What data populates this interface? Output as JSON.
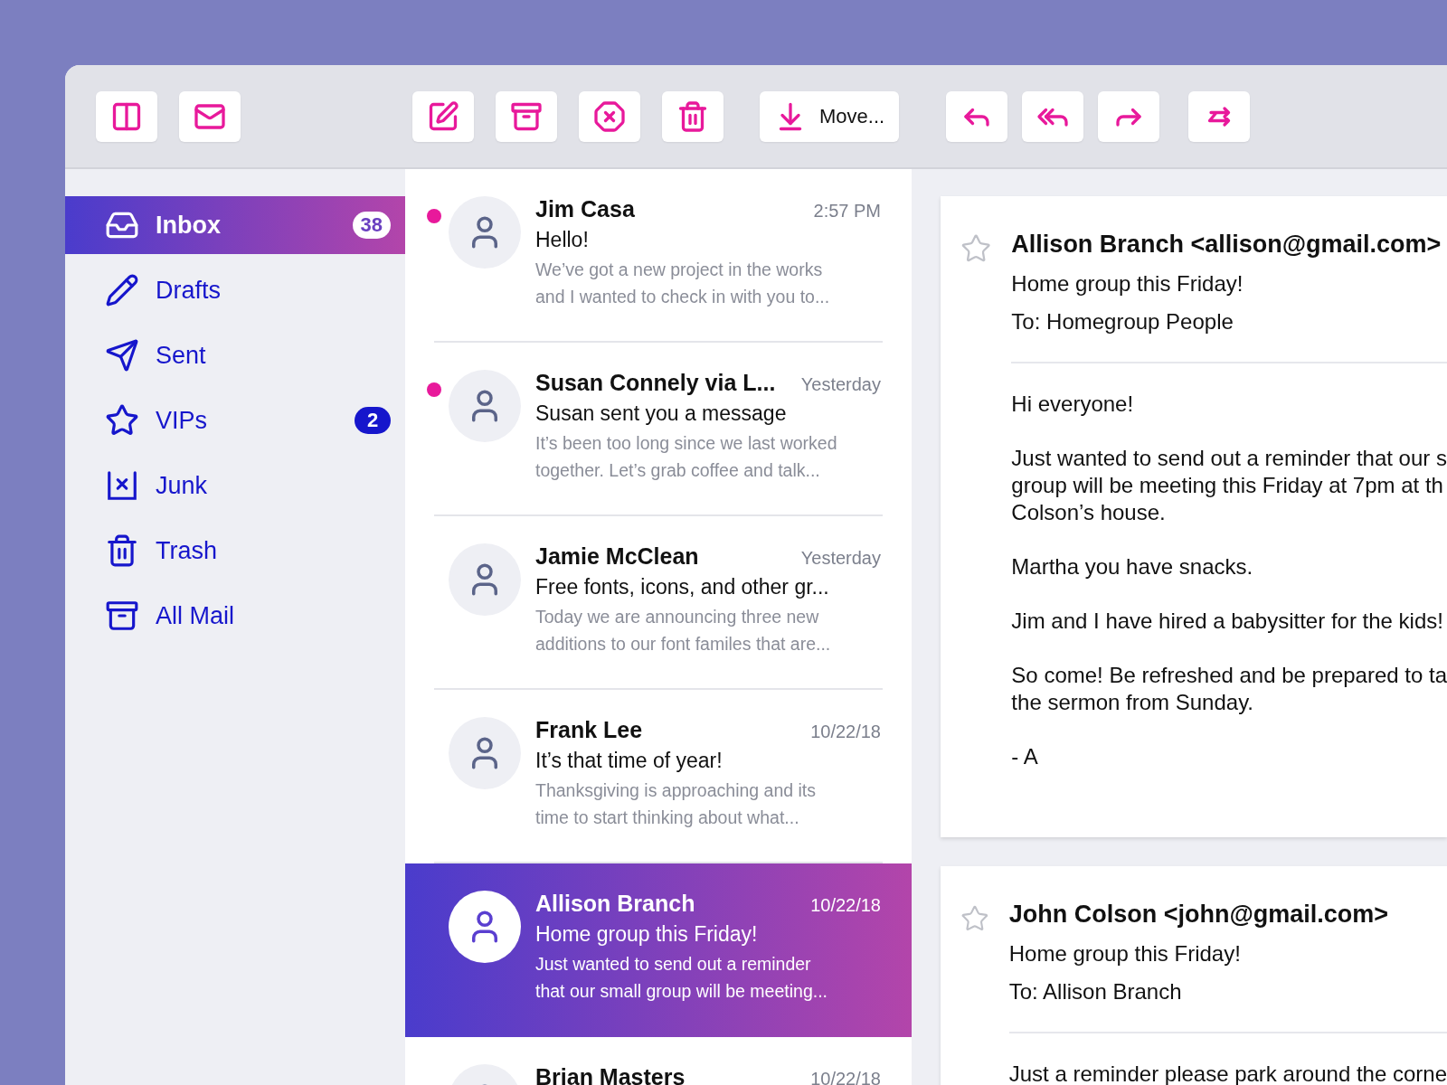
{
  "toolbar": {
    "move_label": "Move..."
  },
  "sidebar": {
    "items": [
      {
        "label": "Inbox",
        "count": "38",
        "selected": true
      },
      {
        "label": "Drafts",
        "selected": false
      },
      {
        "label": "Sent",
        "selected": false
      },
      {
        "label": "VIPs",
        "count": "2",
        "selected": false
      },
      {
        "label": "Junk",
        "selected": false
      },
      {
        "label": "Trash",
        "selected": false
      },
      {
        "label": "All Mail",
        "selected": false
      }
    ]
  },
  "messages": [
    {
      "sender": "Jim Casa",
      "time": "2:57 PM",
      "subject": "Hello!",
      "preview": [
        "We’ve got a new project in the works",
        "and I wanted to check in with you to..."
      ],
      "unread": true,
      "selected": false
    },
    {
      "sender": "Susan Connely via L...",
      "time": "Yesterday",
      "subject": "Susan sent you a message",
      "preview": [
        "It’s been too long since we last worked",
        "together. Let’s grab coffee and talk..."
      ],
      "unread": true,
      "selected": false
    },
    {
      "sender": "Jamie McClean",
      "time": "Yesterday",
      "subject": "Free fonts, icons, and other gr...",
      "preview": [
        "Today we are announcing three new",
        "additions to our font familes that are..."
      ],
      "unread": false,
      "selected": false
    },
    {
      "sender": "Frank Lee",
      "time": "10/22/18",
      "subject": "It’s that time of year!",
      "preview": [
        "Thanksgiving is approaching and its",
        "time to start thinking about what..."
      ],
      "unread": false,
      "selected": false
    },
    {
      "sender": "Allison Branch",
      "time": "10/22/18",
      "subject": "Home group this Friday!",
      "preview": [
        "Just wanted to send out a reminder",
        "that our small group will be meeting..."
      ],
      "unread": false,
      "selected": true
    },
    {
      "sender": "Brian Masters",
      "time": "10/22/18",
      "unread": false,
      "selected": false
    }
  ],
  "thread": [
    {
      "from": "Allison Branch <allison@gmail.com>",
      "subject": "Home group this Friday!",
      "to": "To: Homegroup People",
      "body": [
        [
          "Hi everyone!"
        ],
        [
          "Just wanted to send out a reminder that our s",
          "group will be meeting this Friday at 7pm at th",
          "Colson’s house."
        ],
        [
          "Martha you have snacks."
        ],
        [
          "Jim and I have hired a babysitter for the kids!"
        ],
        [
          "So come! Be refreshed and be prepared to ta",
          "the sermon from Sunday."
        ],
        [
          "- A"
        ]
      ]
    },
    {
      "from": "John Colson <john@gmail.com>",
      "subject": "Home group this Friday!",
      "to": "To: Allison Branch",
      "body": [
        [
          "Just a reminder please park around the corne"
        ]
      ]
    }
  ]
}
